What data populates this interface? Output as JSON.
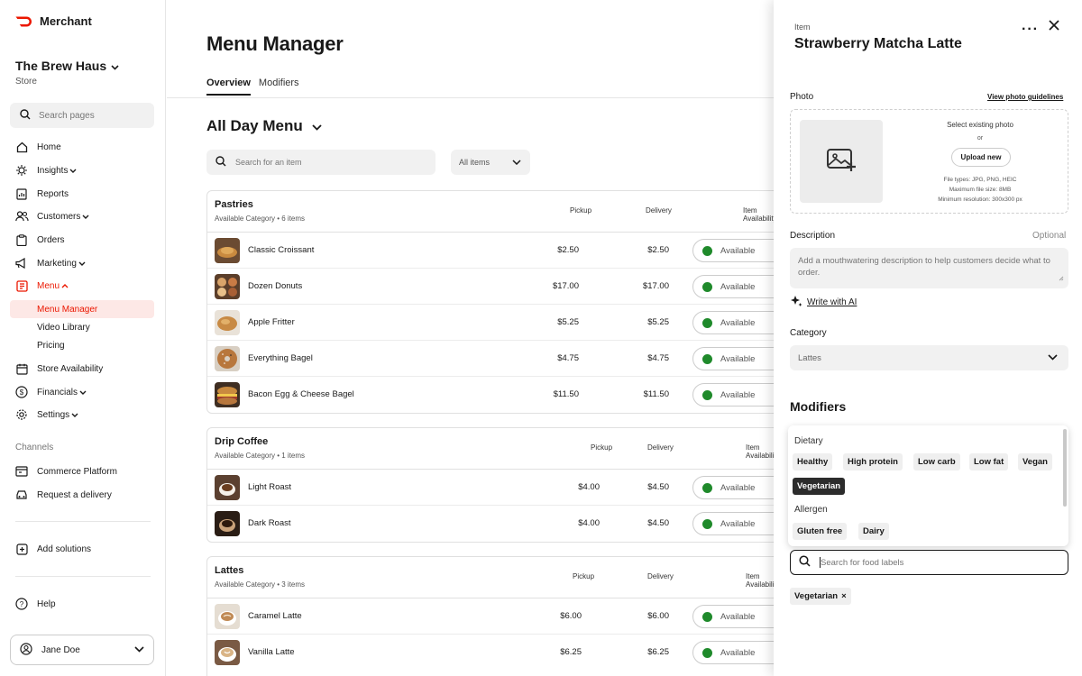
{
  "brand": {
    "name": "Merchant",
    "color": "#eb1700"
  },
  "store": {
    "name": "The Brew Haus",
    "type": "Store"
  },
  "sidebar_search": {
    "placeholder": "Search pages"
  },
  "nav": {
    "home": "Home",
    "insights": "Insights",
    "reports": "Reports",
    "customers": "Customers",
    "orders": "Orders",
    "marketing": "Marketing",
    "menu": "Menu",
    "menu_manager": "Menu Manager",
    "video_library": "Video Library",
    "pricing": "Pricing",
    "store_availability": "Store Availability",
    "financials": "Financials",
    "settings": "Settings",
    "channels": "Channels",
    "commerce_platform": "Commerce Platform",
    "request_delivery": "Request a delivery",
    "add_solutions": "Add solutions",
    "help": "Help"
  },
  "user": {
    "name": "Jane Doe"
  },
  "main": {
    "title": "Menu Manager",
    "tabs": [
      "Overview",
      "Modifiers"
    ],
    "menu_name": "All Day Menu",
    "search_placeholder": "Search for an item",
    "filter": "All items"
  },
  "columns": {
    "pickup": "Pickup",
    "delivery": "Delivery",
    "availability": "Item Availability"
  },
  "categories": [
    {
      "name": "Pastries",
      "sub": "Available Category  •  6 items",
      "items": [
        {
          "name": "Classic Croissant",
          "pickup": "$2.50",
          "delivery": "$2.50",
          "status": "Available"
        },
        {
          "name": "Dozen Donuts",
          "pickup": "$17.00",
          "delivery": "$17.00",
          "status": "Available"
        },
        {
          "name": "Apple Fritter",
          "pickup": "$5.25",
          "delivery": "$5.25",
          "status": "Available"
        },
        {
          "name": "Everything Bagel",
          "pickup": "$4.75",
          "delivery": "$4.75",
          "status": "Available"
        },
        {
          "name": "Bacon Egg & Cheese Bagel",
          "pickup": "$11.50",
          "delivery": "$11.50",
          "status": "Available"
        }
      ]
    },
    {
      "name": "Drip Coffee",
      "sub": "Available Category  •  1 items",
      "items": [
        {
          "name": "Light Roast",
          "pickup": "$4.00",
          "delivery": "$4.50",
          "status": "Available"
        },
        {
          "name": "Dark Roast",
          "pickup": "$4.00",
          "delivery": "$4.50",
          "status": "Available"
        }
      ]
    },
    {
      "name": "Lattes",
      "sub": "Available Category  •  3 items",
      "items": [
        {
          "name": "Caramel Latte",
          "pickup": "$6.00",
          "delivery": "$6.00",
          "status": "Available"
        },
        {
          "name": "Vanilla Latte",
          "pickup": "$6.25",
          "delivery": "$6.25",
          "status": "Available"
        }
      ]
    }
  ],
  "panel": {
    "label": "Item",
    "title": "Strawberry Matcha Latte",
    "photo": {
      "label": "Photo",
      "guidelines": "View photo guidelines",
      "select_existing": "Select existing photo",
      "or": "or",
      "upload": "Upload new",
      "req1": "File types: JPG, PNG, HEIC",
      "req2": "Maximum file size: 8MB",
      "req3": "Minimum resolution: 300x300 px"
    },
    "description": {
      "label": "Description",
      "optional": "Optional",
      "placeholder": "Add a mouthwatering description to help customers decide what to order."
    },
    "write_ai": "Write with AI",
    "category": {
      "label": "Category",
      "value": "Lattes"
    },
    "modifiers": {
      "title": "Modifiers",
      "dietary_label": "Dietary",
      "dietary": [
        "Healthy",
        "High protein",
        "Low carb",
        "Low fat",
        "Vegan",
        "Vegetarian"
      ],
      "allergen_label": "Allergen",
      "allergen": [
        "Gluten free",
        "Dairy"
      ],
      "search_placeholder": "Search for food labels",
      "selected": "Vegetarian"
    }
  },
  "colors": {
    "available": "#1f8a2b",
    "active_nav_bg": "#fde8e6",
    "selected_chip": "#2c2c2c"
  }
}
